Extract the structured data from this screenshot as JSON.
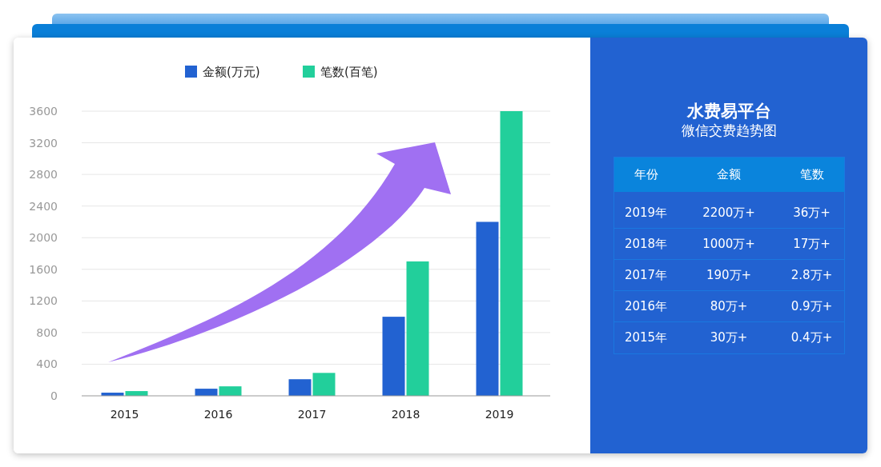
{
  "chart_panel": {
    "chart_data": {
      "type": "bar",
      "categories": [
        "2015",
        "2016",
        "2017",
        "2018",
        "2019"
      ],
      "series": [
        {
          "name": "金额(万元)",
          "color": "#2262d1",
          "values": [
            40,
            90,
            210,
            1000,
            2200
          ]
        },
        {
          "name": "笔数(百笔)",
          "color": "#22cf9b",
          "values": [
            60,
            120,
            290,
            1700,
            3600
          ]
        }
      ],
      "grid": true,
      "legend": true,
      "ylim": [
        0,
        3600
      ],
      "yticks": [
        0,
        400,
        800,
        1200,
        1600,
        2000,
        2400,
        2800,
        3200,
        3600
      ]
    }
  },
  "info_panel": {
    "title": "水费易平台",
    "subtitle": "微信交费趋势图",
    "table": {
      "columns": [
        "年份",
        "金额",
        "笔数"
      ],
      "rows": [
        [
          "2019年",
          "2200万+",
          "36万+"
        ],
        [
          "2018年",
          "1000万+",
          "17万+"
        ],
        [
          "2017年",
          "190万+",
          "2.8万+"
        ],
        [
          "2016年",
          "80万+",
          "0.9万+"
        ],
        [
          "2015年",
          "30万+",
          "0.4万+"
        ]
      ]
    }
  }
}
